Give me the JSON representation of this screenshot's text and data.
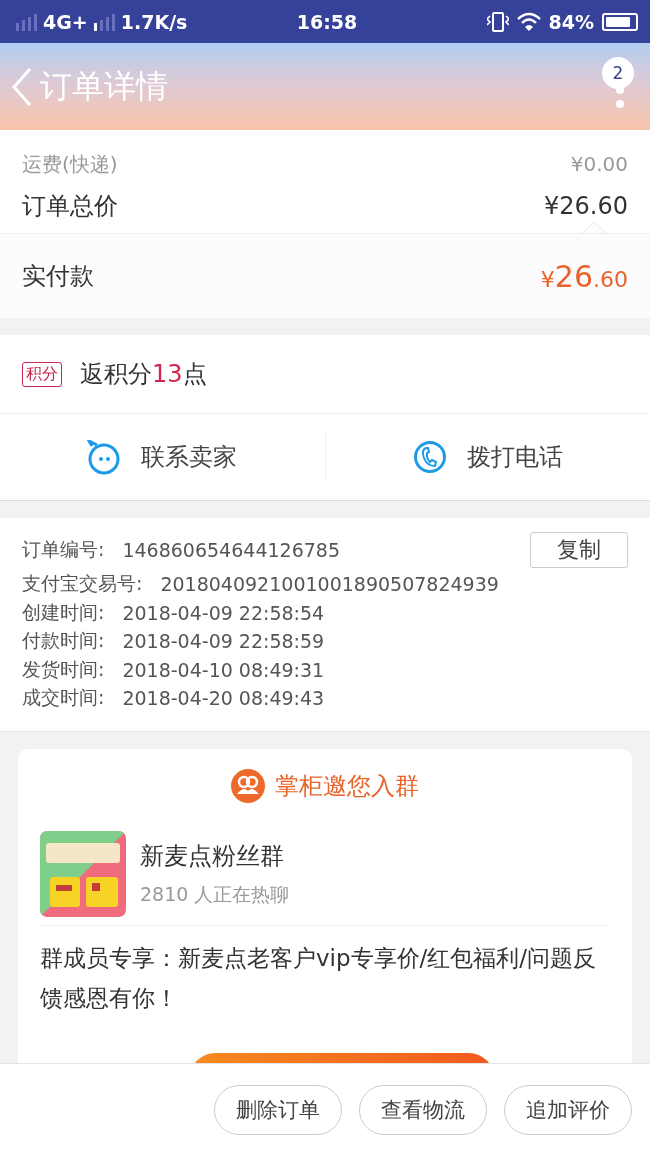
{
  "status_bar": {
    "network": "4G+",
    "speed": "1.7K/s",
    "time": "16:58",
    "battery": "84%"
  },
  "header": {
    "title": "订单详情",
    "badge": "2"
  },
  "prices": [
    {
      "label": "运费(快递)",
      "value": "¥0.00",
      "kind": "minor"
    },
    {
      "label": "订单总价",
      "value": "¥26.60",
      "kind": "total"
    }
  ],
  "paid": {
    "label": "实付款",
    "currency": "¥",
    "integer": "26",
    "decimal": ".60"
  },
  "points": {
    "tag": "积分",
    "prefix": "返积分",
    "count": "13",
    "suffix": "点"
  },
  "contact_actions": [
    {
      "label": "联系卖家",
      "kind": "chat"
    },
    {
      "label": "拨打电话",
      "kind": "phone"
    }
  ],
  "order_info": {
    "copy_button": "复制",
    "fields": [
      {
        "label": "订单编号:",
        "value": "146860654644126785"
      },
      {
        "label": "支付宝交易号:",
        "value": "2018040921001001890507824939"
      },
      {
        "label": "创建时间:",
        "value": "2018-04-09 22:58:54"
      },
      {
        "label": "付款时间:",
        "value": "2018-04-09 22:58:59"
      },
      {
        "label": "发货时间:",
        "value": "2018-04-10 08:49:31"
      },
      {
        "label": "成交时间:",
        "value": "2018-04-20 08:49:43"
      }
    ]
  },
  "group_card": {
    "title": "掌柜邀您入群",
    "name": "新麦点粉丝群",
    "members": "2810 人正在热聊",
    "description": "群成员专享：新麦点老客户vip专享价/红包福利/问题反馈感恩有你！"
  },
  "bottom_buttons": [
    "删除订单",
    "查看物流",
    "追加评价"
  ]
}
